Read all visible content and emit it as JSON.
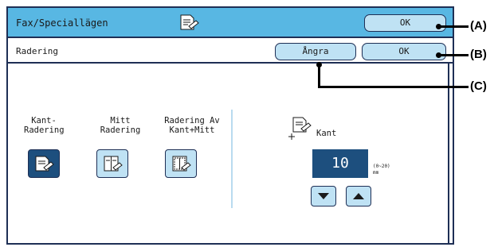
{
  "header": {
    "title": "Fax/Speciallägen",
    "ok_label": "OK"
  },
  "subheader": {
    "title": "Radering",
    "undo_label": "Ångra",
    "ok_label": "OK"
  },
  "modes": [
    {
      "label": "Kant-\nRadering",
      "selected": true
    },
    {
      "label": "Mitt\nRadering",
      "selected": false
    },
    {
      "label": "Radering Av\nKant+Mitt",
      "selected": false
    }
  ],
  "adjust": {
    "label": "Kant",
    "value": "10",
    "range": "(0~20)",
    "unit": "mm"
  },
  "callouts": {
    "a": "(A)",
    "b": "(B)",
    "c": "(C)"
  },
  "colors": {
    "title_bar": "#58b7e3",
    "button": "#bfe2f4",
    "selected": "#1d4f7e",
    "border": "#1e2f55"
  }
}
